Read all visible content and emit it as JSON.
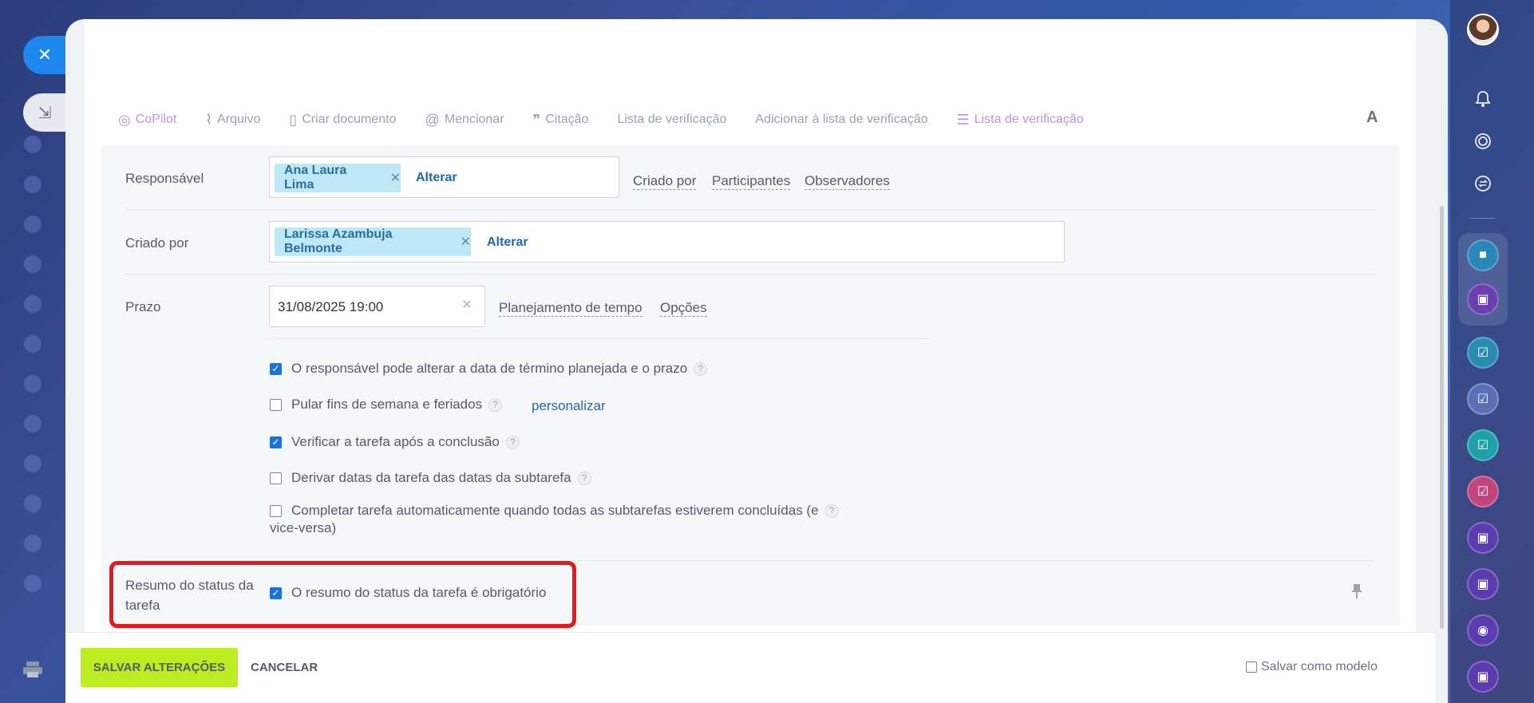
{
  "window": {
    "close_icon": "close-icon",
    "minimize_icon": "minimize-icon"
  },
  "toolbar": {
    "items": [
      {
        "label": "CoPilot",
        "icon": "copilot-icon"
      },
      {
        "label": "Arquivo",
        "icon": "paperclip-icon"
      },
      {
        "label": "Criar documento",
        "icon": "document-icon"
      },
      {
        "label": "Mencionar",
        "icon": "at-icon"
      },
      {
        "label": "Citação",
        "icon": "quote-icon"
      },
      {
        "label": "Lista de verificação",
        "icon": ""
      },
      {
        "label": "Adicionar à lista de verificação",
        "icon": ""
      },
      {
        "label": "Lista de verificação",
        "icon": "checklist-add-icon"
      }
    ],
    "font_label": "A"
  },
  "form": {
    "responsavel": {
      "label": "Responsável",
      "chip": "Ana Laura Lima",
      "change": "Alterar",
      "links": [
        "Criado por",
        "Participantes",
        "Observadores"
      ]
    },
    "criado_por": {
      "label": "Criado por",
      "chip": "Larissa Azambuja Belmonte",
      "change": "Alterar"
    },
    "prazo": {
      "label": "Prazo",
      "value": "31/08/2025 19:00",
      "links": [
        "Planejamento de tempo",
        "Opções"
      ]
    },
    "options": [
      {
        "label": "O responsável pode alterar a data de término planejada e o prazo",
        "checked": true
      },
      {
        "label": "Pular fins de semana e feriados",
        "checked": false,
        "extra_link": "personalizar"
      },
      {
        "label": "Verificar a tarefa após a conclusão",
        "checked": true
      },
      {
        "label": "Derivar datas da tarefa das datas da subtarefa",
        "checked": false
      },
      {
        "label": "Completar tarefa automaticamente quando todas as subtarefas estiverem concluídas (e",
        "label_cont": "vice-versa)",
        "checked": false
      }
    ],
    "status_summary": {
      "label_line1": "Resumo do status da",
      "label_line2": "tarefa",
      "option": "O resumo do status da tarefa é obrigatório",
      "checked": true
    }
  },
  "footer": {
    "save": "SALVAR ALTERAÇÕES",
    "cancel": "CANCELAR",
    "template": "Salvar como modelo"
  },
  "colors": {
    "accent": "#1a73d9",
    "save_button": "#bbed21",
    "chip_bg": "#bce8f8",
    "highlight": "#e8171c",
    "copilot": "#b795e6"
  }
}
